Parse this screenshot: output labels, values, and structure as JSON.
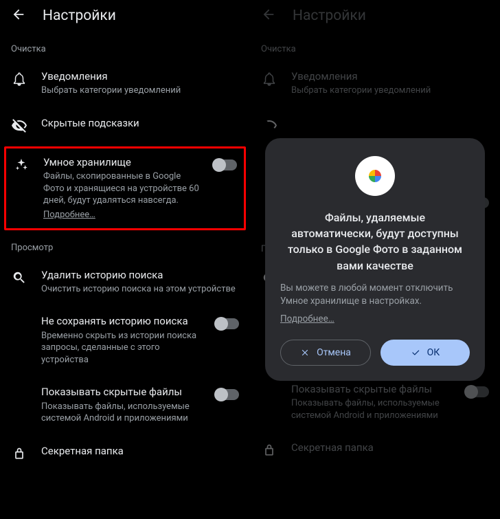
{
  "left": {
    "title": "Настройки",
    "sections": {
      "cleanup": {
        "header": "Очистка",
        "notifications": {
          "title": "Уведомления",
          "sub": "Выбрать категории уведомлений"
        },
        "hidden_hints": {
          "title": "Скрытые подсказки"
        },
        "smart_storage": {
          "title": "Умное хранилище",
          "sub": "Файлы, скопированные в Google Фото и хранящиеся на устройстве 60 дней, будут удаляться навсегда.",
          "link": "Подробнее…"
        }
      },
      "browse": {
        "header": "Просмотр",
        "clear_search": {
          "title": "Удалить историю поиска",
          "sub": "Очистить историю поиска на этом устройстве"
        },
        "no_save_search": {
          "title": "Не сохранять историю поиска",
          "sub": "Временно скрыть из истории поиска запросы, сделанные с этого устройства"
        },
        "show_hidden": {
          "title": "Показывать скрытые файлы",
          "sub": "Показывать файлы, используемые системой Android и приложениями"
        },
        "secret_folder": {
          "title": "Секретная папка"
        }
      }
    }
  },
  "right": {
    "title": "Настройки",
    "sections": {
      "cleanup": {
        "header": "Очистка",
        "notifications": {
          "title": "Уведомления",
          "sub": "Выбрать категории уведомлений"
        }
      },
      "browse": {
        "show_hidden": {
          "title": "Показывать скрытые файлы",
          "sub": "Показывать файлы, используемые системой Android и приложениями"
        },
        "secret_folder": {
          "title": "Секретная папка"
        }
      }
    },
    "dialog": {
      "title": "Файлы, удаляемые автоматически, будут доступны только в Google Фото в заданном вами качестве",
      "body": "Вы можете в любой момент отключить Умное хранилище в настройках.",
      "link": "Подробнее…",
      "cancel": "Отмена",
      "ok": "ОК"
    }
  },
  "partial_header": "Пр"
}
